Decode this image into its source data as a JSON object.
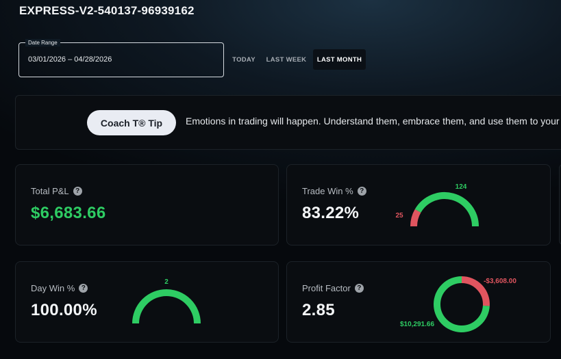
{
  "account": {
    "title": "EXPRESS-V2-540137-96939162"
  },
  "date_range": {
    "legend": "Date Range",
    "value": "03/01/2026 – 04/28/2026",
    "buttons": [
      {
        "label": "TODAY",
        "active": false
      },
      {
        "label": "LAST WEEK",
        "active": false
      },
      {
        "label": "LAST MONTH",
        "active": true
      }
    ]
  },
  "tip": {
    "button_label": "Coach T® Tip",
    "text": "Emotions in trading will happen. Understand them, embrace them, and use them to your a"
  },
  "help_glyph": "?",
  "colors": {
    "positive": "#2ecc63",
    "negative": "#e0555f",
    "track": "#1e252c"
  },
  "cards": {
    "total_pnl": {
      "label": "Total P&L",
      "value": "$6,683.66"
    },
    "trade_win": {
      "label": "Trade Win %",
      "value": "83.22%",
      "wins": 124,
      "losses": 25
    },
    "day_win": {
      "label": "Day Win %",
      "value": "100.00%",
      "wins": 2
    },
    "profit_factor": {
      "label": "Profit Factor",
      "value": "2.85",
      "gross_profit": 10291.66,
      "gross_loss": 3608.0,
      "gross_profit_label": "$10,291.66",
      "gross_loss_label": "-$3,608.00"
    }
  }
}
